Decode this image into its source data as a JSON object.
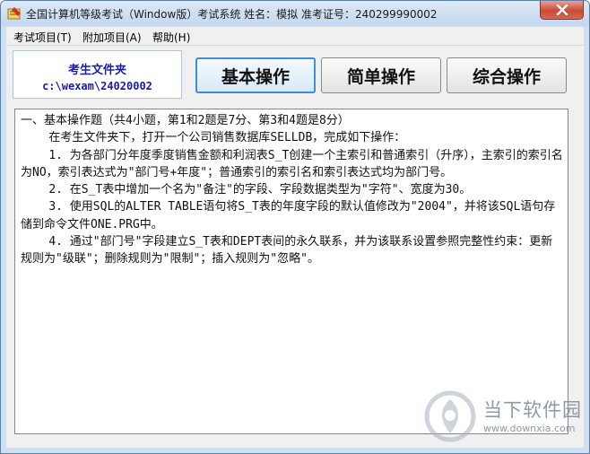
{
  "window": {
    "title": "全国计算机等级考试（Window版）考试系统  姓名：模拟  准考证号：240299990002"
  },
  "menu": [
    {
      "label": "考试项目(T)"
    },
    {
      "label": "附加项目(A)"
    },
    {
      "label": "帮助(H)"
    }
  ],
  "folder": {
    "title": "考生文件夹",
    "path": "c:\\wexam\\24020002"
  },
  "tabs": [
    {
      "label": "基本操作",
      "active": true
    },
    {
      "label": "简单操作",
      "active": false
    },
    {
      "label": "综合操作",
      "active": false
    }
  ],
  "question": {
    "lines": [
      "一、基本操作题（共4小题，第1和2题是7分、第3和4题是8分）",
      "    在考生文件夹下，打开一个公司销售数据库SELLDB，完成如下操作：",
      "    1. 为各部门分年度季度销售金额和利润表S_T创建一个主索引和普通索引（升序），主索引的索引名为NO，索引表达式为\"部门号+年度\"；普通索引的索引名和索引表达式均为部门号。",
      "    2. 在S_T表中增加一个名为\"备注\"的字段、字段数据类型为\"字符\"、宽度为30。",
      "    3. 使用SQL的ALTER TABLE语句将S_T表的年度字段的默认值修改为\"2004\"，并将该SQL语句存储到命令文件ONE.PRG中。",
      "    4. 通过\"部门号\"字段建立S_T表和DEPT表间的永久联系，并为该联系设置参照完整性约束：更新规则为\"级联\"；删除规则为\"限制\"；插入规则为\"忽略\"。"
    ]
  },
  "watermark": {
    "name": "当下软件园",
    "url": "www.downxia.com"
  }
}
